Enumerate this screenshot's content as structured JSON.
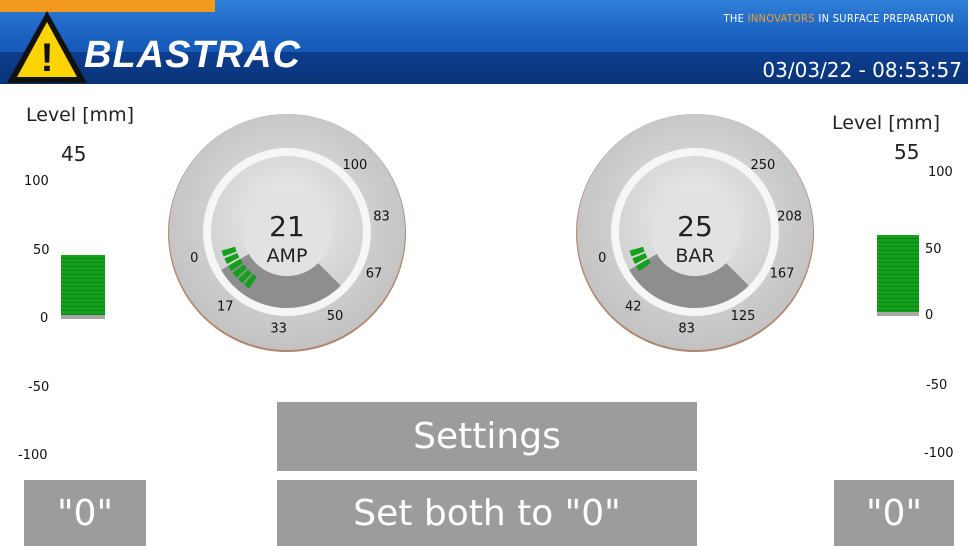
{
  "header": {
    "tagline_prefix": "THE ",
    "tagline_highlight": "INNOVATORS",
    "tagline_suffix": " IN SURFACE PREPARATION",
    "brand": "BLASTRAC",
    "datetime": "03/03/22 - 08:53:57",
    "warning_symbol": "!"
  },
  "left_level": {
    "label": "Level [mm]",
    "value": "45",
    "value_num": 45,
    "ticks": [
      "100",
      "50",
      "0",
      "-50",
      "-100"
    ],
    "zero_button": "\"0\""
  },
  "right_level": {
    "label": "Level [mm]",
    "value": "55",
    "value_num": 55,
    "ticks": [
      "100",
      "50",
      "0",
      "-50",
      "-100"
    ],
    "zero_button": "\"0\""
  },
  "amp_gauge": {
    "value": "21",
    "value_num": 21,
    "unit": "AMP",
    "max": 100,
    "ticks": [
      "0",
      "17",
      "33",
      "50",
      "67",
      "83",
      "100"
    ]
  },
  "bar_gauge": {
    "value": "25",
    "value_num": 25,
    "unit": "BAR",
    "max": 250,
    "ticks": [
      "0",
      "42",
      "83",
      "125",
      "167",
      "208",
      "250"
    ]
  },
  "buttons": {
    "settings": "Settings",
    "set_both": "Set both to \"0\""
  },
  "colors": {
    "header_blue": "#1a60bf",
    "accent_orange": "#f39a1e",
    "level_green": "#13a01c",
    "button_gray": "#9c9c9c"
  },
  "icons": {
    "warning": "warning-triangle-icon"
  }
}
